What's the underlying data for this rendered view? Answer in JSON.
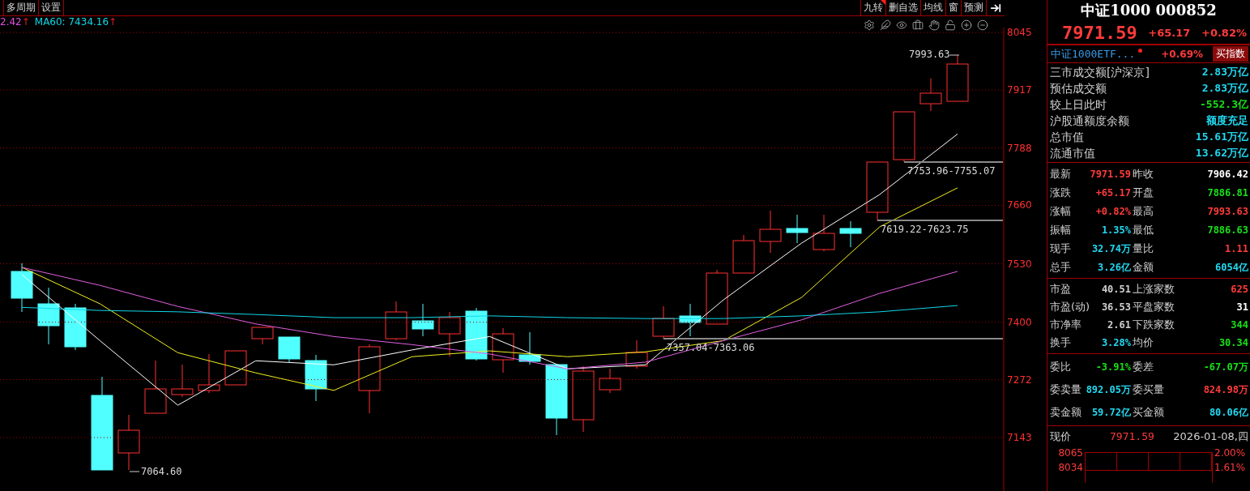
{
  "toolbar_left": [
    {
      "label": "多周期"
    },
    {
      "label": "设置"
    }
  ],
  "toolbar_right": [
    {
      "label": "九转",
      "flagged": true
    },
    {
      "label": "删自选",
      "flagged": false
    },
    {
      "label": "均线",
      "flagged": false
    },
    {
      "label": "窗",
      "flagged": false
    },
    {
      "label": "预测",
      "flagged": false
    }
  ],
  "legend": [
    {
      "text": "2.42",
      "arrow": "↑",
      "color": "#e050e0"
    },
    {
      "text": "MA60: 7434.16",
      "arrow": "↑",
      "color": "#10d8e8"
    }
  ],
  "chart": {
    "chart_data": {
      "type": "line",
      "grid": true,
      "ylim": [
        7024,
        8056
      ],
      "yticks": [
        {
          "value": 8045,
          "label": "8045"
        },
        {
          "value": 7917,
          "label": "7917"
        },
        {
          "value": 7788,
          "label": "7788"
        },
        {
          "value": 7660,
          "label": "7660"
        },
        {
          "value": 7530,
          "label": "7530"
        },
        {
          "value": 7400,
          "label": "7400"
        },
        {
          "value": 7272,
          "label": "7272"
        },
        {
          "value": 7143,
          "label": "7143"
        }
      ],
      "series": [
        {
          "color": "#ffffff",
          "values": [
            7506,
            7359,
            7215,
            7314,
            7305,
            7338,
            7368,
            7296,
            7305,
            7450,
            7576,
            7684,
            7819
          ]
        },
        {
          "color": "#f0f020",
          "values": [
            7522,
            7441,
            7332,
            7287,
            7248,
            7323,
            7336,
            7323,
            7334,
            7359,
            7455,
            7612,
            7699
          ]
        },
        {
          "color": "#e060e0",
          "values": [
            7522,
            7482,
            7435,
            7396,
            7368,
            7350,
            7329,
            7296,
            7311,
            7359,
            7405,
            7464,
            7513
          ]
        },
        {
          "color": "#10d8e8",
          "values": [
            7433,
            7426,
            7423,
            7417,
            7410,
            7410,
            7414,
            7410,
            7408,
            7408,
            7414,
            7423,
            7437
          ]
        }
      ]
    },
    "price_labels": [
      {
        "text": "7993.63",
        "kind": "high"
      },
      {
        "text": "7753.96-7755.07",
        "kind": "gap"
      },
      {
        "text": "7619.22-7623.75",
        "kind": "gap"
      },
      {
        "text": "7357.04-7363.06",
        "kind": "gap"
      },
      {
        "text": "7064.60",
        "kind": "low"
      }
    ]
  },
  "quote": {
    "title": "中证1000 000852",
    "price": "7971.59",
    "change": "+65.17",
    "change_pct": "+0.82%"
  },
  "etf": {
    "name": "中证1000ETF...",
    "change": "+0.69%",
    "button": "买指数"
  },
  "market_rows": [
    {
      "label": "三市成交额[沪深京]",
      "value": "2.83万亿",
      "color": "#22d8f0"
    },
    {
      "label": "预估成交额",
      "value": "2.83万亿",
      "color": "#22d8f0"
    },
    {
      "label": "较上日此时",
      "value": "-552.3亿",
      "color": "#18e018"
    },
    {
      "label": "沪股通额度余额",
      "value": "额度充足",
      "color": "#22d8f0"
    },
    {
      "label": "总市值",
      "value": "15.61万亿",
      "color": "#22d8f0"
    },
    {
      "label": "流通市值",
      "value": "13.62万亿",
      "color": "#22d8f0"
    }
  ],
  "stat_groups": [
    [
      [
        {
          "label": "最新",
          "value": "7971.59",
          "color": "#ff3b3b"
        },
        {
          "label": "昨收",
          "value": "7906.42",
          "color": "#ffffff"
        }
      ],
      [
        {
          "label": "涨跌",
          "value": "+65.17",
          "color": "#ff3b3b"
        },
        {
          "label": "开盘",
          "value": "7886.81",
          "color": "#18e018"
        }
      ],
      [
        {
          "label": "涨幅",
          "value": "+0.82%",
          "color": "#ff3b3b"
        },
        {
          "label": "最高",
          "value": "7993.63",
          "color": "#ff3b3b"
        }
      ],
      [
        {
          "label": "振幅",
          "value": "1.35%",
          "color": "#22d8f0"
        },
        {
          "label": "最低",
          "value": "7886.63",
          "color": "#18e018"
        }
      ],
      [
        {
          "label": "现手",
          "value": "32.74万",
          "color": "#22d8f0"
        },
        {
          "label": "量比",
          "value": "1.11",
          "color": "#ff3b3b"
        }
      ],
      [
        {
          "label": "总手",
          "value": "3.26亿",
          "color": "#22d8f0"
        },
        {
          "label": "金额",
          "value": "6054亿",
          "color": "#22d8f0"
        }
      ]
    ],
    [
      [
        {
          "label": "市盈",
          "value": "40.51",
          "color": "#d0d0d0"
        },
        {
          "label": "上涨家数",
          "value": "625",
          "color": "#ff3b3b"
        }
      ],
      [
        {
          "label": "市盈(动)",
          "value": "36.53",
          "color": "#d0d0d0"
        },
        {
          "label": "平盘家数",
          "value": "31",
          "color": "#ffffff"
        }
      ],
      [
        {
          "label": "市净率",
          "value": "2.61",
          "color": "#d0d0d0"
        },
        {
          "label": "下跌家数",
          "value": "344",
          "color": "#18e018"
        }
      ],
      [
        {
          "label": "换手",
          "value": "3.28%",
          "color": "#22d8f0"
        },
        {
          "label": "均价",
          "value": "30.34",
          "color": "#18e018"
        }
      ]
    ],
    [
      [
        {
          "label": "委比",
          "value": "-3.91%",
          "color": "#18e018"
        },
        {
          "label": "委差",
          "value": "-67.07万",
          "color": "#18e018"
        }
      ],
      [
        {
          "label": "委卖量",
          "value": "892.05万",
          "color": "#22d8f0"
        },
        {
          "label": "委买量",
          "value": "824.98万",
          "color": "#ff3b3b"
        }
      ],
      [
        {
          "label": "卖金额",
          "value": "59.72亿",
          "color": "#22d8f0"
        },
        {
          "label": "买金额",
          "value": "80.06亿",
          "color": "#22d8f0"
        }
      ]
    ]
  ],
  "minute": {
    "label": "现价",
    "price": "7971.59",
    "date": "2026-01-08,四",
    "left_ticks": [
      "8065",
      "8034"
    ],
    "right_ticks": [
      "2.00%",
      "1.61%"
    ]
  }
}
